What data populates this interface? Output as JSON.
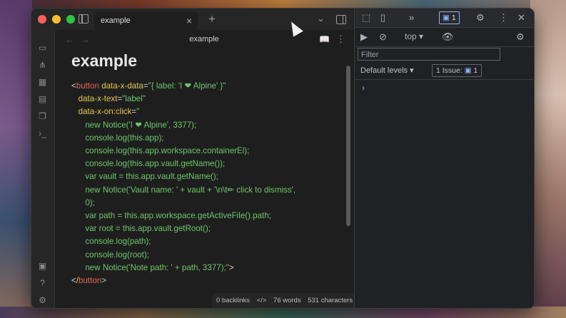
{
  "tab": {
    "title": "example",
    "close": "×",
    "new": "+"
  },
  "view": {
    "title": "example",
    "back": "←",
    "forward": "→"
  },
  "note": {
    "heading": "example",
    "lines": [
      [
        {
          "t": "<",
          "c": "plain"
        },
        {
          "t": "button",
          "c": "tag"
        },
        {
          "t": " data-x-data",
          "c": "attr"
        },
        {
          "t": "=",
          "c": "plain"
        },
        {
          "t": "\"{ label: 'I ❤ Alpine' }\"",
          "c": "str"
        }
      ],
      [
        {
          "t": "   data-x-text",
          "c": "attr"
        },
        {
          "t": "=",
          "c": "plain"
        },
        {
          "t": "\"label\"",
          "c": "str"
        }
      ],
      [
        {
          "t": "   data-x-on:click",
          "c": "attr"
        },
        {
          "t": "=",
          "c": "plain"
        },
        {
          "t": "\"",
          "c": "str"
        }
      ],
      [
        {
          "t": "      new Notice('I ❤ Alpine', 3377);",
          "c": "str"
        }
      ],
      [
        {
          "t": "      console.log(this.app);",
          "c": "str"
        }
      ],
      [
        {
          "t": "      console.log(this.app.workspace.containerEl);",
          "c": "str"
        }
      ],
      [
        {
          "t": "      console.log(this.app.vault.getName());",
          "c": "str"
        }
      ],
      [
        {
          "t": "      var vault = this.app.vault.getName();",
          "c": "str"
        }
      ],
      [
        {
          "t": "      new Notice('Vault name: ' + vault + '\\n\\t✏ click to dismiss',",
          "c": "str"
        }
      ],
      [
        {
          "t": "      0);",
          "c": "str"
        }
      ],
      [
        {
          "t": "      var path = this.app.workspace.getActiveFile().path;",
          "c": "str"
        }
      ],
      [
        {
          "t": "      var root = this.app.vault.getRoot();",
          "c": "str"
        }
      ],
      [
        {
          "t": "      console.log(path);",
          "c": "str"
        }
      ],
      [
        {
          "t": "      console.log(root);",
          "c": "str"
        }
      ],
      [
        {
          "t": "      new Notice('Note path: ' + path, 3377);\"",
          "c": "str"
        },
        {
          "t": ">",
          "c": "plain"
        }
      ],
      [
        {
          "t": "</",
          "c": "plain"
        },
        {
          "t": "button",
          "c": "tag"
        },
        {
          "t": ">",
          "c": "plain"
        }
      ]
    ]
  },
  "status": {
    "backlinks": "0 backlinks",
    "words": "76 words",
    "characters": "531 characters"
  },
  "devtools": {
    "issues_count": "1",
    "context": "top ▾",
    "filter_placeholder": "Filter",
    "levels": "Default levels ▾",
    "issue_label": "1 Issue:",
    "issue_num": "1",
    "prompt": "›"
  },
  "colors": {
    "tag": "#e0674d",
    "attr": "#e6c84e",
    "str": "#6ec76a",
    "plain": "#cfcfcf"
  }
}
